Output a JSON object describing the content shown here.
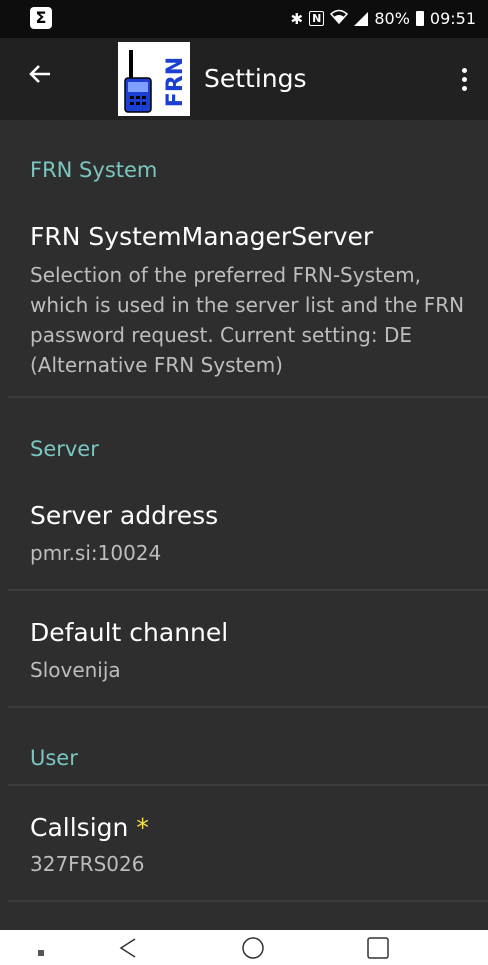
{
  "status_bar": {
    "left_icon": "Σ",
    "battery_percent": "80%",
    "time": "09:51",
    "icons": [
      "bluetooth-icon",
      "nfc-icon",
      "wifi-icon",
      "signal-icon",
      "battery-icon"
    ]
  },
  "toolbar": {
    "title": "Settings",
    "logo_text": "FRN"
  },
  "sections": {
    "frn_system": {
      "header": "FRN System",
      "items": [
        {
          "title": "FRN SystemManagerServer",
          "summary": "Selection of the preferred FRN-System, which is used in the server list and the FRN password request. Current setting: DE (Alternative FRN System)"
        }
      ]
    },
    "server": {
      "header": "Server",
      "items": [
        {
          "title": "Server address",
          "summary": "pmr.si:10024"
        },
        {
          "title": "Default channel",
          "summary": "Slovenija"
        }
      ]
    },
    "user": {
      "header": "User",
      "items": [
        {
          "title": "Callsign",
          "required_mark": "*",
          "summary": "327FRS026"
        }
      ]
    }
  },
  "colors": {
    "background": "#2e2e2e",
    "toolbar": "#212121",
    "section_header": "#7ac6c0",
    "required_mark": "#f5e04a"
  }
}
